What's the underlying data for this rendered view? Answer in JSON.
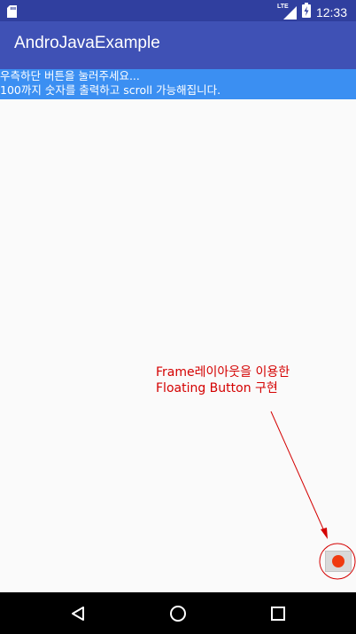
{
  "status_bar": {
    "time": "12:33",
    "network_label": "LTE",
    "icons": [
      "sd-card-icon",
      "lte-signal-icon",
      "battery-charging-icon"
    ]
  },
  "app_bar": {
    "title": "AndroJavaExample"
  },
  "info_box": {
    "line1": "우측하단 버튼을 눌러주세요...",
    "line2": "100까지 숫자를 출력하고 scroll 가능해집니다."
  },
  "annotation": {
    "line1": "Frame레이아웃을 이용한",
    "line2": "Floating Button 구현",
    "color": "#d40000"
  },
  "fab": {
    "icon": "red-dot-icon",
    "color": "#f03a10"
  },
  "nav_bar": {
    "icons": [
      "back-icon",
      "home-icon",
      "recents-icon"
    ]
  },
  "colors": {
    "status_bar": "#303f9f",
    "app_bar": "#3f51b5",
    "info_box": "#3b8ff2",
    "background": "#fafafa"
  }
}
